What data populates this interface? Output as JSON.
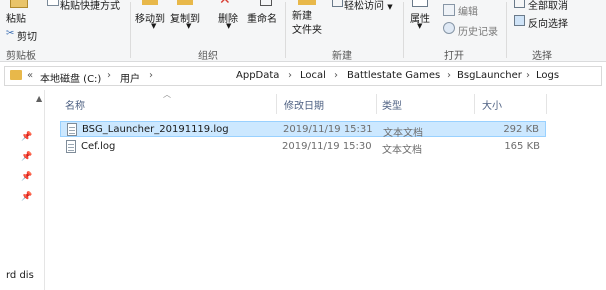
{
  "ribbon": {
    "clipboard": {
      "paste": "粘贴",
      "paste_shortcut": "粘贴快捷方式",
      "cut": "剪切",
      "group_label": "剪贴板"
    },
    "organize": {
      "move_to": "移动到",
      "copy_to": "复制到",
      "delete": "删除",
      "rename": "重命名",
      "group_label": "组织"
    },
    "new": {
      "new_folder": "新建\n文件夹",
      "easy_access": "轻松访问",
      "group_label": "新建"
    },
    "open": {
      "properties": "属性",
      "edit": "编辑",
      "history": "历史记录",
      "group_label": "打开"
    },
    "select": {
      "select_none": "全部取消",
      "invert_selection": "反向选择",
      "group_label": "选择"
    }
  },
  "address_bar": {
    "overflow": "«",
    "path": [
      "本地磁盘 (C:)",
      "用户",
      "AppData",
      "Local",
      "Battlestate Games",
      "BsgLauncher",
      "Logs"
    ]
  },
  "columns": {
    "name": "名称",
    "modified": "修改日期",
    "type": "类型",
    "size": "大小"
  },
  "files": [
    {
      "name": "BSG_Launcher_20191119.log",
      "modified": "2019/11/19 15:31",
      "type": "文本文档",
      "size": "292 KB",
      "selected": true
    },
    {
      "name": "Cef.log",
      "modified": "2019/11/19 15:30",
      "type": "文本文档",
      "size": "165 KB",
      "selected": false
    }
  ],
  "nav_pane": {
    "truncated_item": "rd dis"
  },
  "colors": {
    "selection_bg": "#cce8ff",
    "selection_border": "#99d1ff",
    "folder": "#e8b84a",
    "header_text": "#4d6082"
  }
}
